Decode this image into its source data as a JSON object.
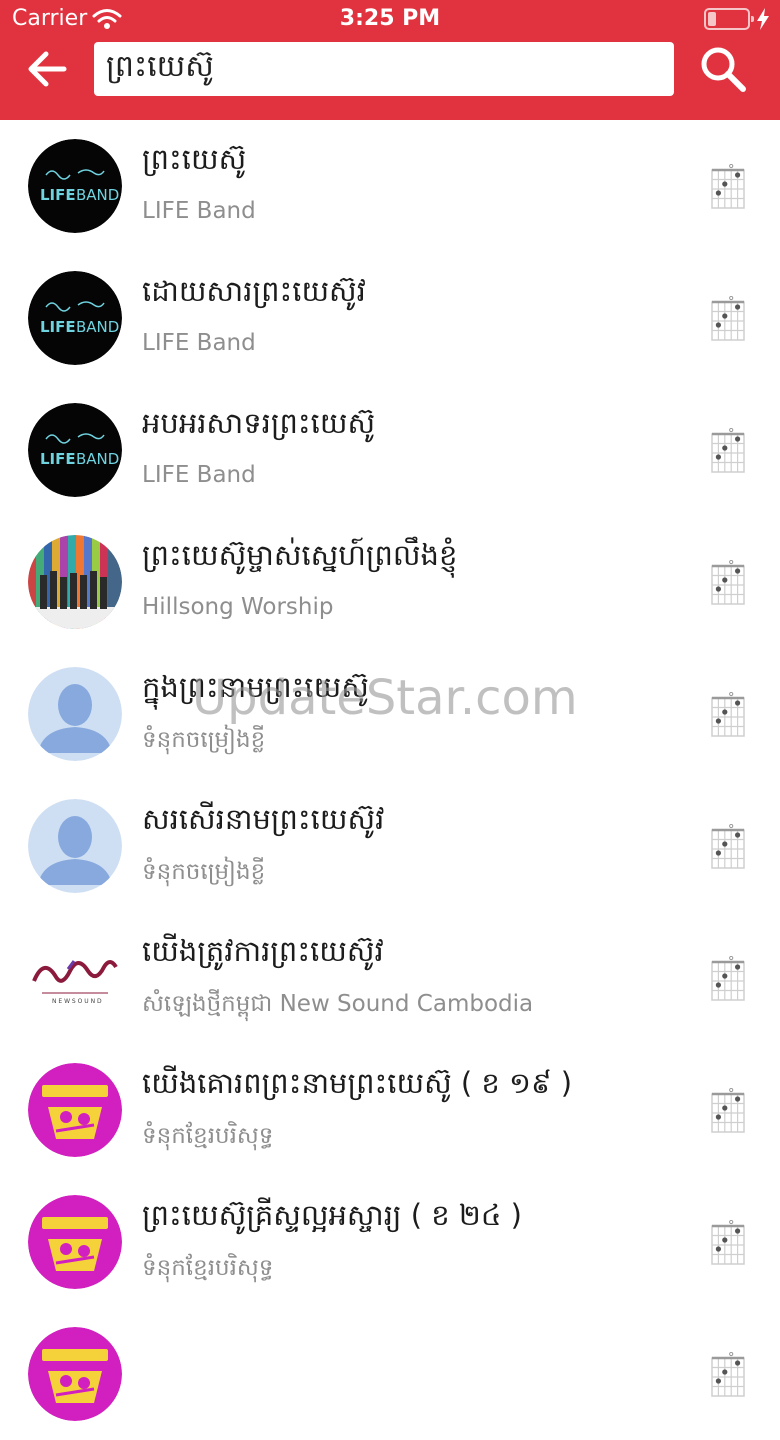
{
  "status_bar": {
    "carrier": "Carrier",
    "time": "3:25 PM"
  },
  "search": {
    "value": "ព្រះយេស៊ូ"
  },
  "colors": {
    "header_bg": "#e0333f",
    "title_text": "#1c1c1c",
    "subtitle_text": "#8e8e8e",
    "profile_avatar_bg": "#cfdff3",
    "profile_avatar_fg": "#88a9de",
    "magenta_logo_bg": "#d21fbf"
  },
  "results": [
    {
      "title": "ព្រះយេស៊ូ",
      "artist": "LIFE Band",
      "avatar": "life-band-logo"
    },
    {
      "title": "ដោយសារព្រះយេស៊ូវ",
      "artist": "LIFE Band",
      "avatar": "life-band-logo"
    },
    {
      "title": "អបអរសាទរព្រះយេស៊ូ",
      "artist": "LIFE Band",
      "avatar": "life-band-logo"
    },
    {
      "title": "ព្រះយេស៊ូម្ចាស់ស្នេហ៍ព្រលឹងខ្ញុំ",
      "artist": "Hillsong Worship",
      "avatar": "group-photo"
    },
    {
      "title": "ក្នុងព្រះនាមព្រះយេស៊ូ",
      "artist": "ទំនុកចម្រៀងខ្លី",
      "avatar": "default-profile"
    },
    {
      "title": "សរសើរនាមព្រះយេស៊ូវ",
      "artist": "ទំនុកចម្រៀងខ្លី",
      "avatar": "default-profile"
    },
    {
      "title": "យើងត្រូវការព្រះយេស៊ូវ",
      "artist": "សំឡេងថ្មីកម្ពុជា New Sound Cambodia",
      "avatar": "new-sound-logo"
    },
    {
      "title": "យើងគោរពព្រះនាមព្រះយេស៊ូ ( ខ ១៩ )",
      "artist": "ទំនុកខ្មែរបរិសុទ្ធ",
      "avatar": "hymnal-logo"
    },
    {
      "title": "ព្រះយេស៊ូគ្រីស្ទល្អអស្ចារ្យ ( ខ ២៤ )",
      "artist": "ទំនុកខ្មែរបរិសុទ្ធ",
      "avatar": "hymnal-logo"
    },
    {
      "title": "",
      "artist": "",
      "avatar": "hymnal-logo"
    }
  ],
  "watermark": "UpdateStar.com",
  "icons": {
    "back": "arrow-left-icon",
    "search": "magnifier-icon",
    "chord": "guitar-chord-icon",
    "wifi": "wifi-icon",
    "battery": "battery-icon",
    "charging": "charging-bolt-icon"
  }
}
